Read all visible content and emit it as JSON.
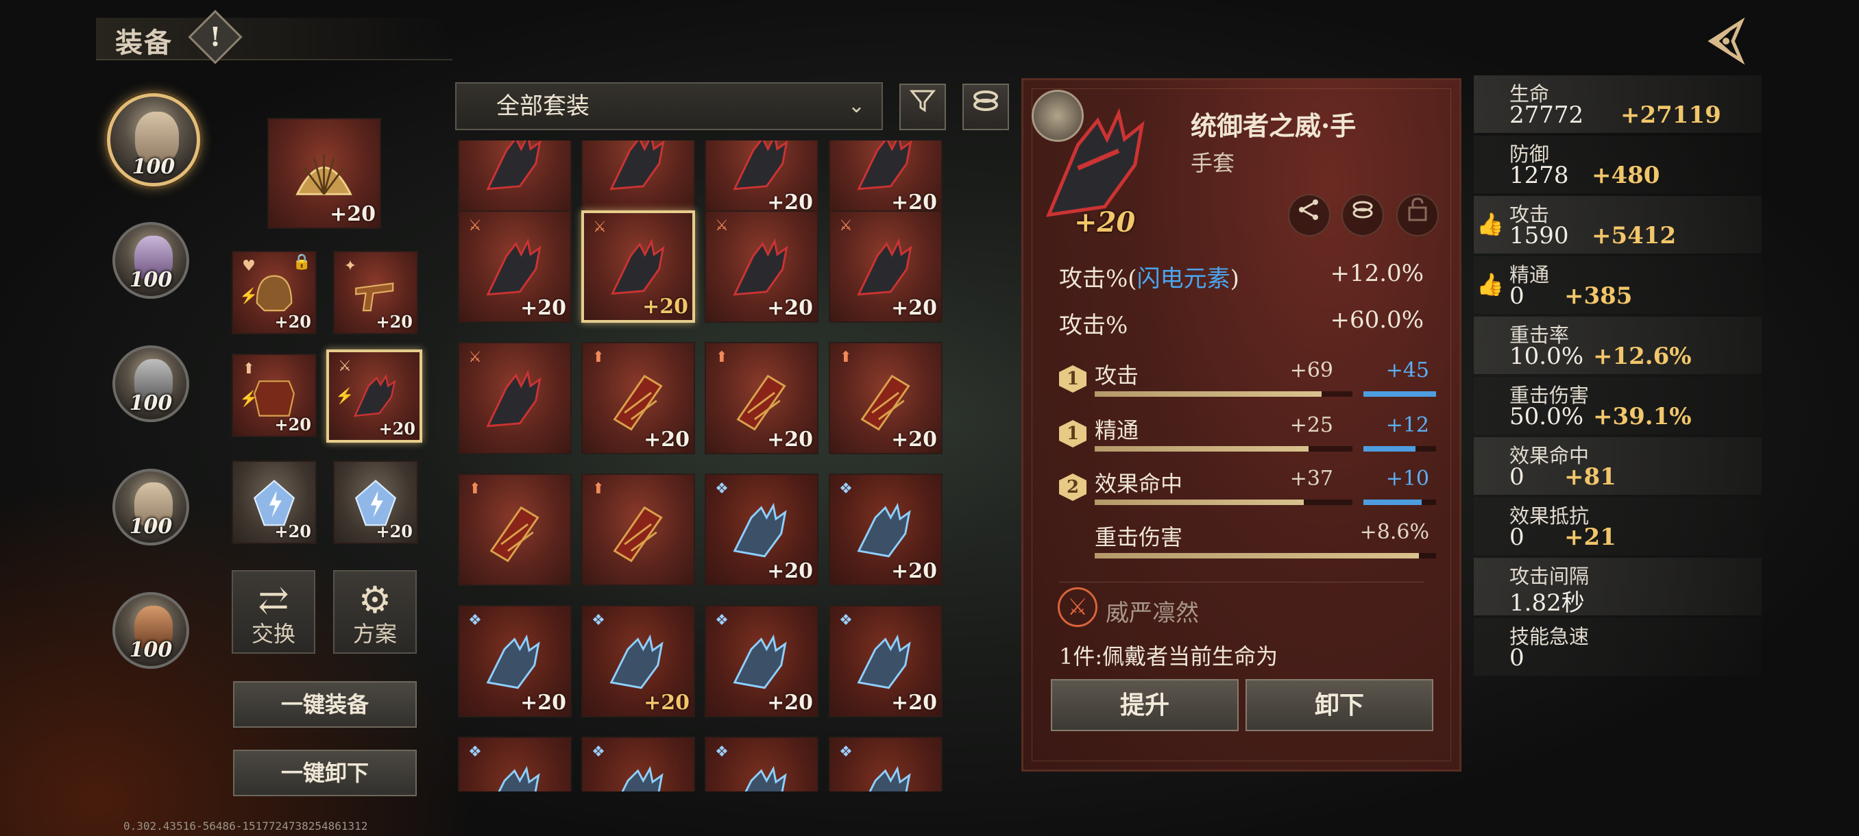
{
  "header": {
    "title": "装备",
    "info_icon": "!",
    "back_icon": "back-arrow"
  },
  "heroes": [
    {
      "level": "100",
      "active": true
    },
    {
      "level": "100",
      "active": false
    },
    {
      "level": "100",
      "active": false
    },
    {
      "level": "100",
      "active": false
    },
    {
      "level": "100",
      "active": false
    }
  ],
  "equipped": {
    "weapon": {
      "plus": "+20"
    },
    "slots": [
      {
        "plus": "+20",
        "locked": true
      },
      {
        "plus": "+20"
      },
      {
        "plus": "+20"
      },
      {
        "plus": "+20",
        "selected": true
      },
      {
        "plus": "+20"
      },
      {
        "plus": "+20"
      }
    ]
  },
  "side_buttons": {
    "swap_label": "交换",
    "plan_label": "方案",
    "equip_all_label": "一键装备",
    "unequip_all_label": "一键卸下"
  },
  "version": "0.302.43516-56486-1517724738254861312",
  "filter": {
    "selected": "全部套装",
    "filter_icon": "funnel",
    "sort_icon": "rings"
  },
  "inventory": {
    "rows": [
      [
        {
          "plus": ""
        },
        {
          "plus": ""
        },
        {
          "plus": "+20"
        },
        {
          "plus": "+20"
        }
      ],
      [
        {
          "plus": "+20"
        },
        {
          "plus": "+20",
          "gold": true,
          "selected": true
        },
        {
          "plus": "+20"
        },
        {
          "plus": "+20"
        }
      ],
      [
        {
          "plus": ""
        },
        {
          "plus": "+20"
        },
        {
          "plus": "+20"
        },
        {
          "plus": "+20"
        }
      ],
      [
        {
          "plus": ""
        },
        {
          "plus": ""
        },
        {
          "plus": "+20"
        },
        {
          "plus": "+20"
        }
      ],
      [
        {
          "plus": "+20"
        },
        {
          "plus": "+20",
          "gold": true
        },
        {
          "plus": "+20"
        },
        {
          "plus": "+20"
        }
      ],
      [
        {
          "plus": ""
        },
        {
          "plus": ""
        },
        {
          "plus": ""
        },
        {
          "plus": ""
        }
      ]
    ]
  },
  "detail": {
    "name": "统御者之威·手",
    "type": "手套",
    "plus": "+20",
    "main_stats": [
      {
        "name_prefix": "攻击%(",
        "element": "闪电元素",
        "name_suffix": ")",
        "value": "+12.0%"
      },
      {
        "name": "攻击%",
        "value": "+60.0%"
      }
    ],
    "sub_stats": [
      {
        "rank": "1",
        "name": "攻击",
        "base": "+69",
        "add": "+45",
        "base_fill": 0.88,
        "add_fill": 1.0
      },
      {
        "rank": "1",
        "name": "精通",
        "base": "+25",
        "add": "+12",
        "base_fill": 0.83,
        "add_fill": 0.72
      },
      {
        "rank": "2",
        "name": "效果命中",
        "base": "+37",
        "add": "+10",
        "base_fill": 0.81,
        "add_fill": 0.8
      }
    ],
    "crit_dmg": {
      "name": "重击伤害",
      "value": "+8.6%",
      "fill": 0.95
    },
    "set_name": "威严凛然",
    "set_desc": "1件:佩戴者当前生命为",
    "upgrade_label": "提升",
    "unequip_label": "卸下"
  },
  "stats": [
    {
      "label": "生命",
      "base": "27772",
      "bonus": "+27119",
      "thumb": false
    },
    {
      "label": "防御",
      "base": "1278",
      "bonus": "+480",
      "thumb": false
    },
    {
      "label": "攻击",
      "base": "1590",
      "bonus": "+5412",
      "thumb": true
    },
    {
      "label": "精通",
      "base": "0",
      "bonus": "+385",
      "thumb": true
    },
    {
      "label": "重击率",
      "base": "10.0%",
      "bonus": "+12.6%",
      "thumb": false
    },
    {
      "label": "重击伤害",
      "base": "50.0%",
      "bonus": "+39.1%",
      "thumb": false
    },
    {
      "label": "效果命中",
      "base": "0",
      "bonus": "+81",
      "thumb": false
    },
    {
      "label": "效果抵抗",
      "base": "0",
      "bonus": "+21",
      "thumb": false
    },
    {
      "label": "攻击间隔",
      "base": "1.82秒",
      "bonus": "",
      "thumb": false
    },
    {
      "label": "技能急速",
      "base": "0",
      "bonus": "",
      "thumb": false
    }
  ]
}
